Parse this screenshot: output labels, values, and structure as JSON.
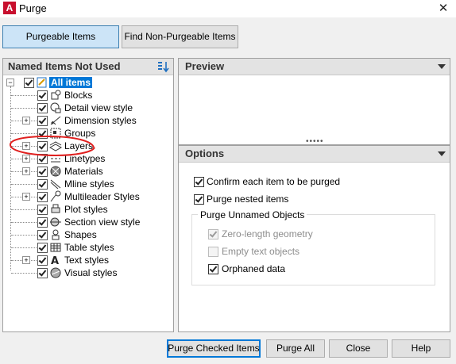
{
  "window": {
    "title": "Purge",
    "app_icon_letter": "A",
    "close_glyph": "✕"
  },
  "top_tabs": {
    "purgeable": "Purgeable Items",
    "non_purgeable": "Find Non-Purgeable Items"
  },
  "tree": {
    "header": "Named Items Not Used",
    "root": "All items",
    "items": [
      {
        "label": "Blocks",
        "icon": "blocks-icon",
        "expandable": false
      },
      {
        "label": "Detail view style",
        "icon": "detail-view-icon",
        "expandable": false
      },
      {
        "label": "Dimension styles",
        "icon": "dimension-icon",
        "expandable": true
      },
      {
        "label": "Groups",
        "icon": "groups-icon",
        "expandable": false
      },
      {
        "label": "Layers",
        "icon": "layers-icon",
        "expandable": true
      },
      {
        "label": "Linetypes",
        "icon": "linetypes-icon",
        "expandable": true
      },
      {
        "label": "Materials",
        "icon": "materials-icon",
        "expandable": true
      },
      {
        "label": "Mline styles",
        "icon": "mline-icon",
        "expandable": false
      },
      {
        "label": "Multileader Styles",
        "icon": "multileader-icon",
        "expandable": true
      },
      {
        "label": "Plot styles",
        "icon": "plot-icon",
        "expandable": false
      },
      {
        "label": "Section view style",
        "icon": "section-view-icon",
        "expandable": false
      },
      {
        "label": "Shapes",
        "icon": "shapes-icon",
        "expandable": false
      },
      {
        "label": "Table styles",
        "icon": "table-icon",
        "expandable": false
      },
      {
        "label": "Text styles",
        "icon": "text-style-icon",
        "expandable": true
      },
      {
        "label": "Visual styles",
        "icon": "visual-style-icon",
        "expandable": false
      }
    ]
  },
  "preview": {
    "header": "Preview"
  },
  "options": {
    "header": "Options",
    "confirm": "Confirm each item to be purged",
    "nested": "Purge nested items",
    "group_title": "Purge Unnamed Objects",
    "zero_length": "Zero-length geometry",
    "empty_text": "Empty text objects",
    "orphaned": "Orphaned data"
  },
  "buttons": {
    "purge_checked": "Purge Checked Items",
    "purge_all": "Purge All",
    "close": "Close",
    "help": "Help"
  },
  "colors": {
    "selection": "#0078d7",
    "annotation": "#e0201f",
    "accent_button": "#cce4f7"
  }
}
